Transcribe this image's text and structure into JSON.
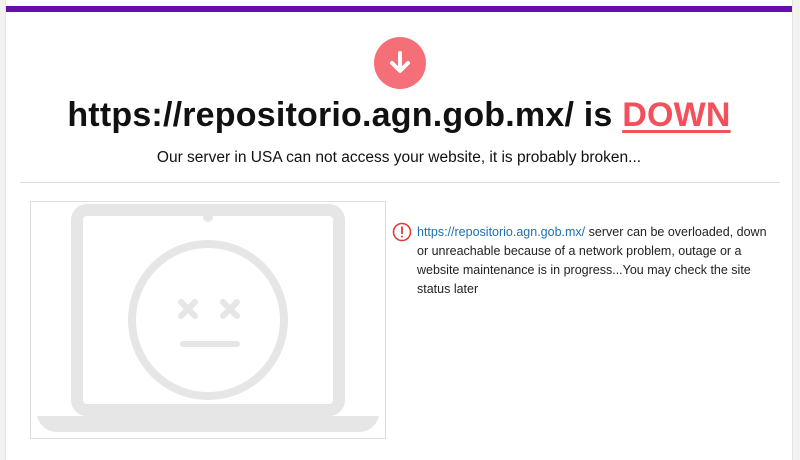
{
  "colors": {
    "top_bar": "#6a0dad",
    "down": "#f2505a",
    "badge": "#f46f77",
    "link": "#1f6fb2",
    "illustration": "#e6e6e6"
  },
  "header": {
    "badge_icon": "arrow-down-icon",
    "url": "https://repositorio.agn.gob.mx/",
    "is_text": "is",
    "status": "DOWN",
    "subtitle": "Our server in USA can not access your website, it is probably broken..."
  },
  "illustration": {
    "icon": "broken-laptop-sad-face-icon"
  },
  "notice": {
    "icon": "exclamation-circle-icon",
    "link_text": "https://repositorio.agn.gob.mx/",
    "text": " server can be overloaded, down or unreachable because of a network problem, outage or a website maintenance is in progress...You may check the site status later"
  }
}
